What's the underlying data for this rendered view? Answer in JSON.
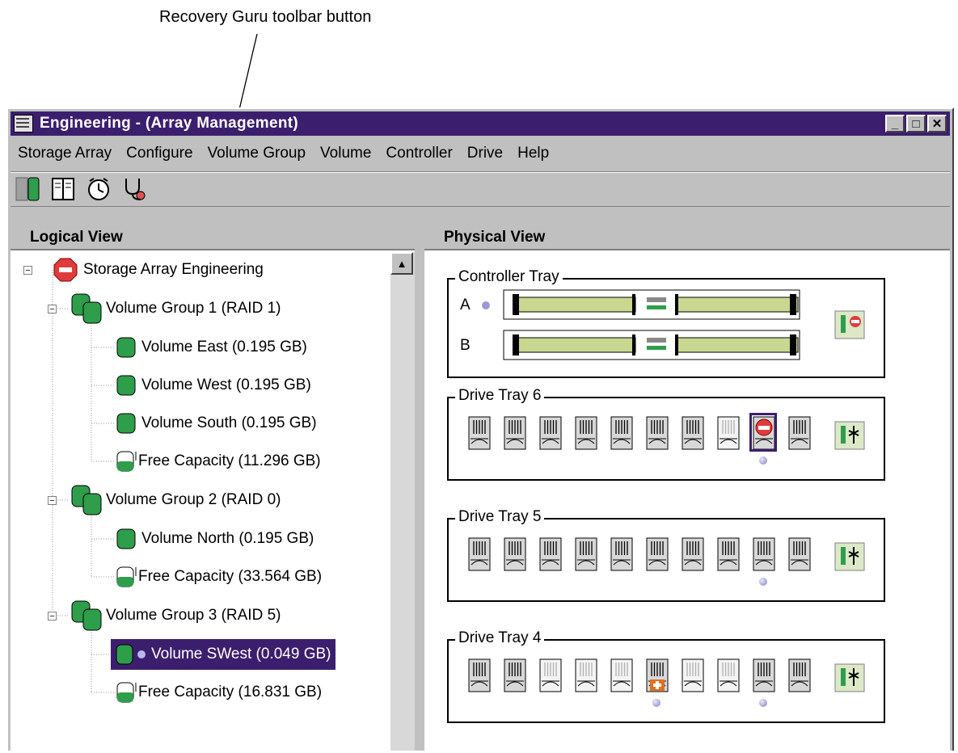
{
  "callout": {
    "text": "Recovery Guru toolbar button"
  },
  "window": {
    "title": "Engineering - (Array Management)"
  },
  "window_controls": [
    "_",
    "□",
    "✕"
  ],
  "menu": [
    {
      "label": "Storage Array"
    },
    {
      "label": "Configure"
    },
    {
      "label": "Volume Group"
    },
    {
      "label": "Volume"
    },
    {
      "label": "Controller"
    },
    {
      "label": "Drive"
    },
    {
      "label": "Help"
    }
  ],
  "toolbar": {
    "icons": [
      "create-volume-icon",
      "volume-icon",
      "performance-monitor-icon",
      "clock-icon",
      "recovery-guru-icon"
    ]
  },
  "logical_view": {
    "title": "Logical View",
    "nodes": [
      {
        "label": "Storage Array Engineering",
        "icon": "storage-array-error-icon",
        "level": 0
      },
      {
        "label": "Volume Group 1 (RAID 1)",
        "icon": "volume-group-icon",
        "level": 1
      },
      {
        "label": "Volume East  (0.195 GB)",
        "icon": "volume-icon",
        "level": 2
      },
      {
        "label": "Volume West  (0.195 GB)",
        "icon": "volume-icon",
        "level": 2
      },
      {
        "label": "Volume South (0.195 GB)",
        "icon": "volume-icon",
        "level": 2
      },
      {
        "label": "Free Capacity (11.296 GB)",
        "icon": "free-capacity-icon",
        "level": 2
      },
      {
        "label": "Volume Group 2 (RAID 0)",
        "icon": "volume-group-icon",
        "level": 1
      },
      {
        "label": "Volume North (0.195 GB)",
        "icon": "volume-icon",
        "level": 2
      },
      {
        "label": "Free Capacity (33.564 GB)",
        "icon": "free-capacity-icon",
        "level": 2
      },
      {
        "label": "Volume Group 3 (RAID 5)",
        "icon": "volume-group-icon",
        "level": 1
      },
      {
        "label": "Volume SWest  (0.049 GB)",
        "icon": "volume-icon",
        "level": 2,
        "selected": true
      },
      {
        "label": "Free Capacity (16.831 GB)",
        "icon": "free-capacity-icon",
        "level": 2
      }
    ]
  },
  "physical_view": {
    "title": "Physical View",
    "controller_tray": {
      "title": "Controller Tray",
      "controllers": [
        "A",
        "B"
      ]
    },
    "drive_trays": [
      {
        "title": "Drive Tray 6"
      },
      {
        "title": "Drive Tray 5"
      },
      {
        "title": "Drive Tray 4"
      }
    ]
  },
  "colors": {
    "title_bar": "#3c1e6e",
    "volume": "#2e9e4a",
    "chrome": "#c0c0c0"
  }
}
